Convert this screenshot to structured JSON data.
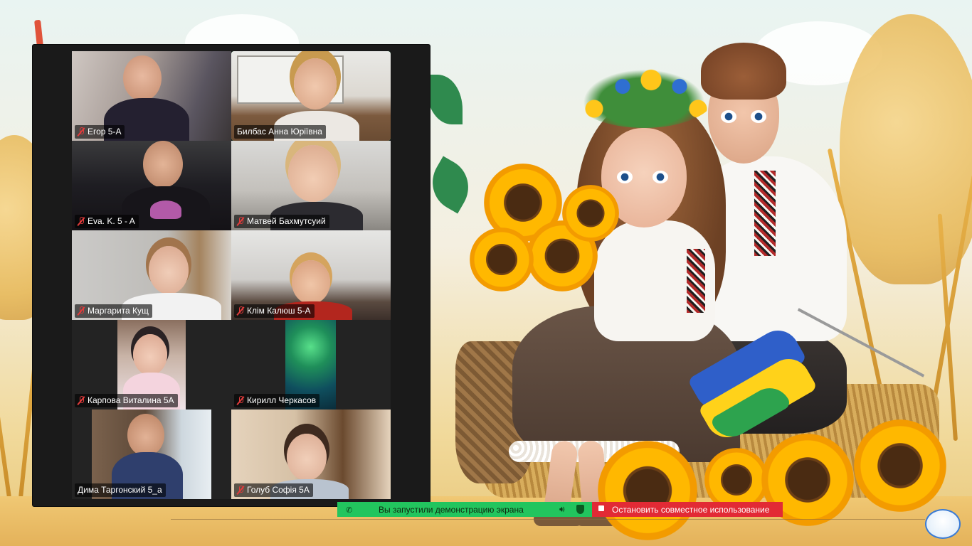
{
  "gallery": {
    "participants": [
      {
        "name": "Егор 5-А",
        "muted": true,
        "active_speaker": false
      },
      {
        "name": "Билбас Анна Юріївна",
        "muted": false,
        "active_speaker": true
      },
      {
        "name": "Eva. K. 5 - A",
        "muted": true,
        "active_speaker": false
      },
      {
        "name": "Матвей Бахмутсуий",
        "muted": true,
        "active_speaker": false
      },
      {
        "name": "Маргарита Кущ",
        "muted": true,
        "active_speaker": false
      },
      {
        "name": "Клім Калюш 5-А",
        "muted": true,
        "active_speaker": false
      },
      {
        "name": "Карпова Виталина 5А",
        "muted": true,
        "active_speaker": false
      },
      {
        "name": "Кирилл Черкасов",
        "muted": true,
        "active_speaker": false
      },
      {
        "name": "Дима Таргонский 5_а",
        "muted": false,
        "active_speaker": false
      },
      {
        "name": "Голуб Софія 5А",
        "muted": true,
        "active_speaker": false
      }
    ]
  },
  "share_banner": {
    "status_text": "Вы запустили демонстрацию экрана",
    "stop_label": "Остановить совместное использование",
    "status_color": "#22c55e",
    "stop_color": "#e22a35"
  },
  "colors": {
    "active_speaker_border": "#2ed573",
    "muted_icon": "#e23b3b",
    "flag_blue": "#2f5fc9",
    "flag_yellow": "#ffd21a"
  },
  "icons": [
    "mic-muted-icon",
    "phone-icon",
    "speaker-icon",
    "shield-icon",
    "stop-icon"
  ]
}
